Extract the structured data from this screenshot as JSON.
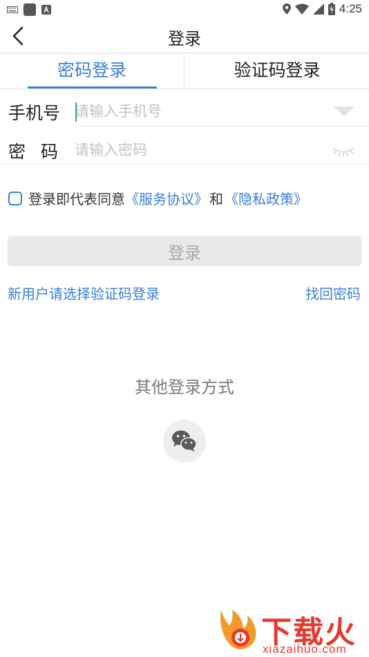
{
  "status_bar": {
    "time": "4:25"
  },
  "header": {
    "title": "登录"
  },
  "tabs": [
    {
      "label": "密码登录",
      "active": true
    },
    {
      "label": "验证码登录",
      "active": false
    }
  ],
  "form": {
    "phone_label": "手机号",
    "phone_placeholder": "请输入手机号",
    "password_label": "密码",
    "password_placeholder": "请输入密码"
  },
  "agreement": {
    "prefix": "登录即代表同意",
    "service_link": "《服务协议》",
    "and": "和",
    "privacy_link": "《隐私政策》"
  },
  "login_button": "登录",
  "links": {
    "new_user": "新用户请选择验证码登录",
    "forgot": "找回密码"
  },
  "other_login": {
    "title": "其他登录方式"
  },
  "watermark": {
    "brand": "下载火",
    "url": "xiazaihuo.com"
  },
  "colors": {
    "accent": "#3a7ed8",
    "watermark": "#e8382e"
  }
}
